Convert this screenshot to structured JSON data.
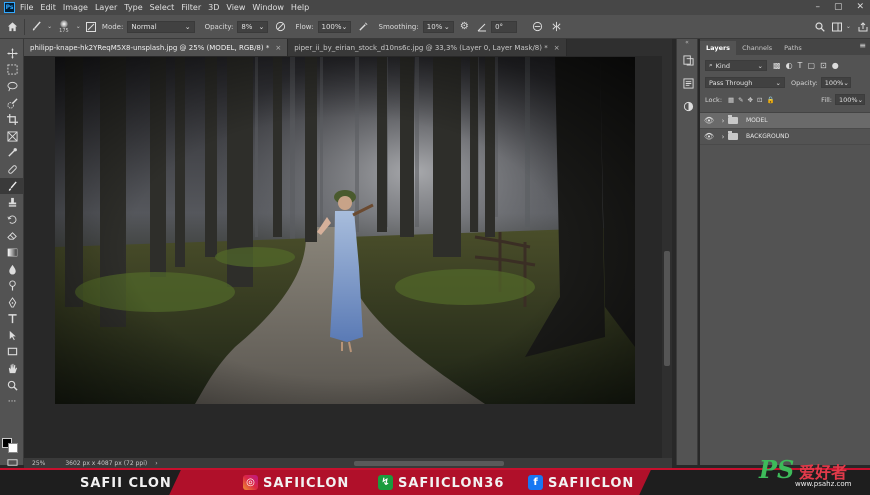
{
  "menubar": {
    "logo": "Ps",
    "items": [
      "File",
      "Edit",
      "Image",
      "Layer",
      "Type",
      "Select",
      "Filter",
      "3D",
      "View",
      "Window",
      "Help"
    ],
    "window_controls": [
      "–",
      "▢",
      "✕"
    ]
  },
  "options": {
    "brush_size": "175",
    "mode_label": "Mode:",
    "mode_value": "Normal",
    "opacity_label": "Opacity:",
    "opacity_value": "8%",
    "flow_label": "Flow:",
    "flow_value": "100%",
    "smoothing_label": "Smoothing:",
    "smoothing_value": "10%",
    "angle_value": "0°"
  },
  "tabs": [
    {
      "label": "philipp-knape-hk2YReqM5X8-unsplash.jpg @ 25% (MODEL, RGB/8) *",
      "close": "×"
    },
    {
      "label": "piper_ii_by_eirian_stock_d10ns6c.jpg @ 33,3% (Layer 0, Layer Mask/8) *",
      "close": "×"
    }
  ],
  "status": {
    "zoom": "25%",
    "doc_size": "3602 px x 4087 px (72 ppi)"
  },
  "layers_panel": {
    "tabs": [
      "Layers",
      "Channels",
      "Paths"
    ],
    "kind_label": "Kind",
    "blend_mode": "Pass Through",
    "opacity_label": "Opacity:",
    "opacity_value": "100%",
    "lock_label": "Lock:",
    "fill_label": "Fill:",
    "fill_value": "100%",
    "layers": [
      {
        "name": "MODEL",
        "selected": true
      },
      {
        "name": "BACKGROUND",
        "selected": false
      }
    ]
  },
  "banner": {
    "left_name": "SAFII CLON",
    "instagram": "SAFIICLON",
    "other": "SAFIICLON36",
    "facebook": "SAFIICLON"
  },
  "watermark": {
    "brand": "PS",
    "tagline": "爱好者",
    "url": "www.psahz.com"
  },
  "colors": {
    "accent_red": "#c8102e",
    "foreground": "#000000",
    "background": "#ffffff"
  }
}
